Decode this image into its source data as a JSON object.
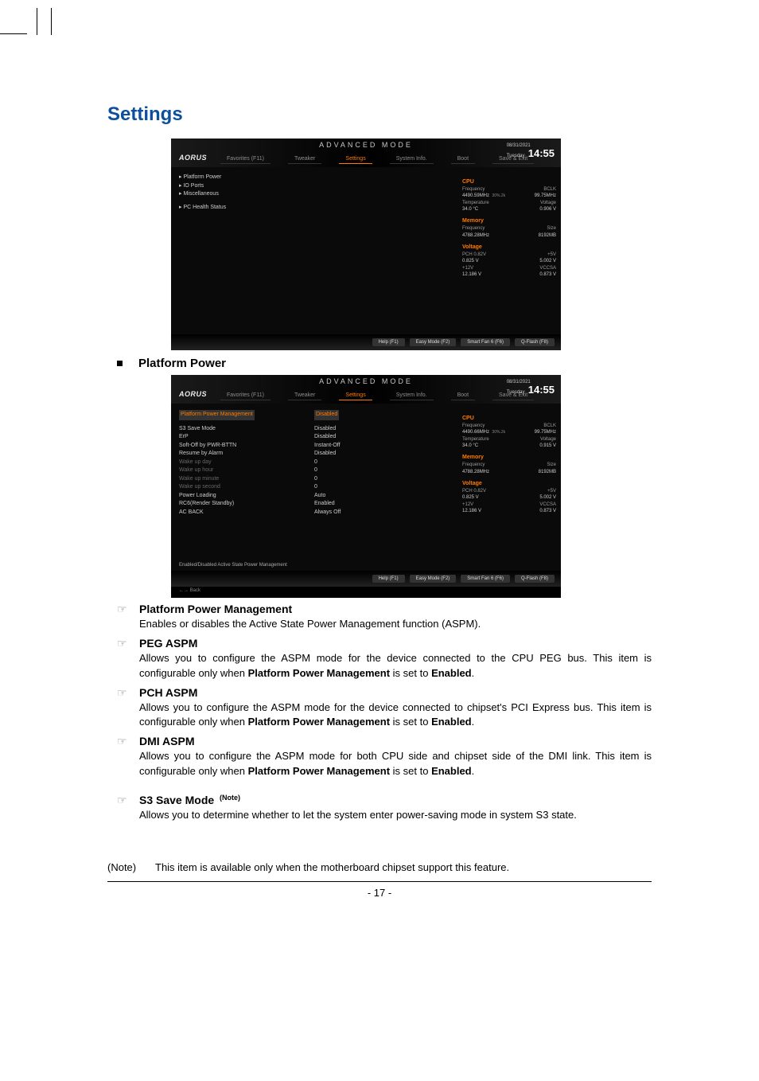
{
  "title": "Settings",
  "subsection": "Platform Power",
  "bios_common": {
    "advanced_mode": "ADVANCED MODE",
    "logo": "AORUS",
    "date": "08/31/2021",
    "day": "Tuesday",
    "time": "14:55",
    "tabs": [
      "Favorites (F11)",
      "Tweaker",
      "Settings",
      "System Info.",
      "Boot",
      "Save & Exit"
    ],
    "footer_buttons": [
      "Help (F1)",
      "Easy Mode (F2)",
      "Smart Fan 6 (F6)",
      "Q-Flash (F8)"
    ],
    "right_panel": {
      "cpu_h": "CPU",
      "cpu_freq_l": "Frequency",
      "cpu_freq_v": "4490.59MHz",
      "cpu_freq2_l": "BCLK",
      "cpu_freq2_v": "99.75MHz",
      "cpu_temp_l": "Temperature",
      "cpu_temp_v": "34.0 °C",
      "cpu_volt_l": "Voltage",
      "cpu_volt_v": "0.906 V",
      "mem_h": "Memory",
      "mem_freq_l": "Frequency",
      "mem_freq_v": "4788.28MHz",
      "mem_size_l": "Size",
      "mem_size_v": "8192MB",
      "vol_h": "Voltage",
      "vol1_l": "PCH 0.82V",
      "vol1_v": "0.825 V",
      "vol2_l": "+5V",
      "vol2_v": "5.002 V",
      "vol3_l": "+12V",
      "vol3_v": "12.186 V",
      "vol4_l": "VCCSA",
      "vol4_v": "0.873 V"
    }
  },
  "bios_shot1": {
    "menu": [
      "Platform Power",
      "IO Ports",
      "Miscellaneous",
      "PC Health Status"
    ]
  },
  "bios_shot2": {
    "header_item": "Platform Power Management",
    "header_val": "Disabled",
    "rows": [
      {
        "l": "S3 Save Mode",
        "v": "Disabled"
      },
      {
        "l": "ErP",
        "v": "Disabled"
      },
      {
        "l": "Soft-Off by PWR-BTTN",
        "v": "Instant-Off"
      },
      {
        "l": "Resume by Alarm",
        "v": "Disabled"
      },
      {
        "l": "  Wake up day",
        "v": "0",
        "dim": true
      },
      {
        "l": "  Wake up hour",
        "v": "0",
        "dim": true
      },
      {
        "l": "  Wake up minute",
        "v": "0",
        "dim": true
      },
      {
        "l": "  Wake up second",
        "v": "0",
        "dim": true
      },
      {
        "l": "Power Loading",
        "v": "Auto"
      },
      {
        "l": "RC6(Render Standby)",
        "v": "Enabled"
      },
      {
        "l": "AC BACK",
        "v": "Always Off"
      }
    ],
    "hint": "Enabled/Disabled Active State Power Management",
    "back": "←→   Back",
    "right_cpu_freq_v": "4490.66MHz",
    "right_cpu_volt_v": "0.915 V"
  },
  "items": [
    {
      "title": "Platform Power Management",
      "desc": "Enables or disables the Active State Power Management function (ASPM)."
    },
    {
      "title": "PEG ASPM",
      "desc_pre": "Allows you to configure the ASPM mode for the device connected to the CPU PEG bus. This item is configurable only when ",
      "b1": "Platform Power Management",
      "desc_mid": " is set to ",
      "b2": "Enabled",
      "desc_post": "."
    },
    {
      "title": "PCH ASPM",
      "desc_pre": "Allows you to configure the ASPM mode for the device connected to chipset's PCI Express bus. This item is configurable only when ",
      "b1": "Platform Power Management",
      "desc_mid": " is set to ",
      "b2": "Enabled",
      "desc_post": "."
    },
    {
      "title": "DMI ASPM",
      "desc_pre": "Allows you to configure the ASPM mode for both CPU side and chipset side of the DMI link. This item is configurable only when ",
      "b1": "Platform Power Management",
      "desc_mid": " is set to ",
      "b2": "Enabled",
      "desc_post": "."
    },
    {
      "title": "S3 Save Mode",
      "note_sup": "(Note)",
      "desc": "Allows you to determine whether to let the system enter power-saving mode in system S3 state."
    }
  ],
  "footnote_label": "(Note)",
  "footnote_text": "This item is available only when the motherboard chipset support this feature.",
  "page_num": "- 17 -"
}
